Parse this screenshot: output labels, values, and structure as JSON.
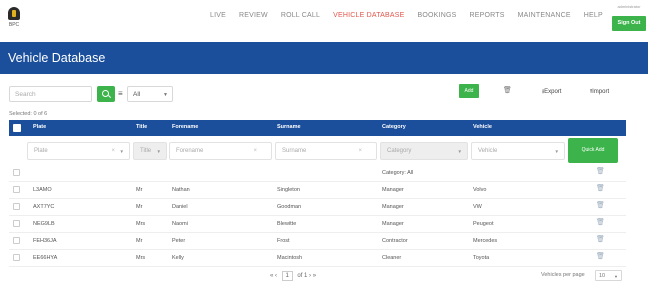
{
  "app": {
    "logo_text": "BPC"
  },
  "nav": {
    "items": [
      {
        "label": "LIVE"
      },
      {
        "label": "REVIEW"
      },
      {
        "label": "ROLL CALL"
      },
      {
        "label": "VEHICLE DATABASE",
        "active": true
      },
      {
        "label": "BOOKINGS"
      },
      {
        "label": "REPORTS"
      },
      {
        "label": "MAINTENANCE"
      },
      {
        "label": "HELP"
      }
    ],
    "user_label": "administrator",
    "sign_out": "Sign Out"
  },
  "page": {
    "title": "Vehicle Database"
  },
  "toolbar": {
    "search_placeholder": "Search",
    "filter_value": "All",
    "add_label": "Add",
    "export_label": "Export",
    "import_label": "Import",
    "selected_text": "Selected: 0 of 6"
  },
  "table": {
    "headers": [
      "Plate",
      "Title",
      "Forename",
      "Surname",
      "Category",
      "Vehicle"
    ],
    "filters": {
      "plate": "Plate",
      "title": "Title",
      "forename": "Forename",
      "surname": "Surname",
      "category": "Category",
      "vehicle": "Vehicle",
      "quick_add": "Quick Add"
    },
    "category_row": "Category: All",
    "rows": [
      [
        "L3AMO",
        "Mr",
        "Nathan",
        "Singleton",
        "Manager",
        "Volvo"
      ],
      [
        "AXT7YC",
        "Mr",
        "Daniel",
        "Goodman",
        "Manager",
        "VW"
      ],
      [
        "NEG9LB",
        "Mrs",
        "Naomi",
        "Blewitte",
        "Manager",
        "Peugeot"
      ],
      [
        "FEH36JA",
        "Mr",
        "Peter",
        "Frost",
        "Contractor",
        "Mercedes"
      ],
      [
        "EE66HYA",
        "Mrs",
        "Kelly",
        "Macintosh",
        "Cleaner",
        "Toyota"
      ]
    ]
  },
  "pagination": {
    "first": "«",
    "prev": "‹",
    "page": "1",
    "of_text": "of 1",
    "next": "›",
    "last": "»",
    "per_page_label": "Vehicles per page",
    "per_page_value": "10"
  },
  "colors": {
    "brand": "#1b4f9c",
    "accent": "#3cb44b",
    "active_nav": "#e2574c"
  }
}
